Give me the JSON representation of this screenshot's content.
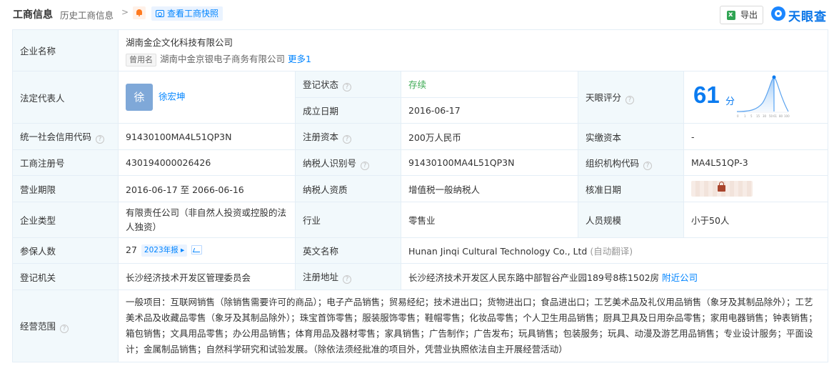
{
  "header": {
    "title": "工商信息",
    "history_link": "历史工商信息",
    "chevron": ">",
    "snapshot_button": "查看工商快照",
    "export_button": "导出",
    "brand": "天眼查"
  },
  "company": {
    "name_label": "企业名称",
    "name": "湖南金企文化科技有限公司",
    "used_name_tag": "曾用名",
    "used_name": "湖南中金京银电子商务有限公司",
    "more_link": "更多1"
  },
  "legal_rep": {
    "label": "法定代表人",
    "avatar_char": "徐",
    "name": "徐宏坤"
  },
  "status": {
    "label": "登记状态",
    "value": "存续"
  },
  "established": {
    "label": "成立日期",
    "value": "2016-06-17"
  },
  "score": {
    "label": "天眼评分",
    "value": "61",
    "unit": "分",
    "axis_labels": [
      "0",
      "1",
      "5",
      "15",
      "30",
      "50",
      "61",
      "80",
      "100"
    ]
  },
  "credit_code": {
    "label": "统一社会信用代码",
    "value": "91430100MA4L51QP3N"
  },
  "reg_capital": {
    "label": "注册资本",
    "value": "200万人民币"
  },
  "paid_capital": {
    "label": "实缴资本",
    "value": "-"
  },
  "reg_number": {
    "label": "工商注册号",
    "value": "430194000026426"
  },
  "taxpayer_id": {
    "label": "纳税人识别号",
    "value": "91430100MA4L51QP3N"
  },
  "org_code": {
    "label": "组织机构代码",
    "value": "MA4L51QP-3"
  },
  "term": {
    "label": "营业期限",
    "value": "2016-06-17 至 2066-06-16"
  },
  "taxpayer_qual": {
    "label": "纳税人资质",
    "value": "增值税一般纳税人"
  },
  "approval_date": {
    "label": "核准日期",
    "value": ""
  },
  "company_type": {
    "label": "企业类型",
    "value": "有限责任公司（非自然人投资或控股的法人独资）"
  },
  "industry": {
    "label": "行业",
    "value": "零售业"
  },
  "staff_size": {
    "label": "人员规模",
    "value": "小于50人"
  },
  "insured": {
    "label": "参保人数",
    "value": "27",
    "badge": "2023年报"
  },
  "english_name": {
    "label": "英文名称",
    "value": "Hunan Jinqi Cultural Technology Co., Ltd",
    "note": "(自动翻译)"
  },
  "reg_authority": {
    "label": "登记机关",
    "value": "长沙经济技术开发区管理委员会"
  },
  "reg_address": {
    "label": "注册地址",
    "value": "长沙经济技术开发区人民东路中部智谷产业园189号8栋1502房",
    "nearby_link": "附近公司"
  },
  "scope": {
    "label": "经营范围",
    "value": "一般项目：互联网销售（除销售需要许可的商品）；电子产品销售；贸易经纪；技术进出口；货物进出口；食品进出口；工艺美术品及礼仪用品销售（象牙及其制品除外）；工艺美术品及收藏品零售（象牙及其制品除外）；珠宝首饰零售；服装服饰零售；鞋帽零售；化妆品零售；个人卫生用品销售；厨具卫具及日用杂品零售；家用电器销售；钟表销售；箱包销售；文具用品零售；办公用品销售；体育用品及器材零售；家具销售；广告制作；广告发布；玩具销售；包装服务；玩具、动漫及游艺用品销售；专业设计服务；平面设计；金属制品销售；自然科学研究和试验发展。（除依法须经批准的项目外，凭营业执照依法自主开展经营活动）"
  },
  "colors": {
    "link": "#0084ff",
    "key_bg": "#f2f9fc",
    "border": "#e4eef6",
    "status_green": "#3eab54",
    "score_blue": "#0a7bf0"
  }
}
